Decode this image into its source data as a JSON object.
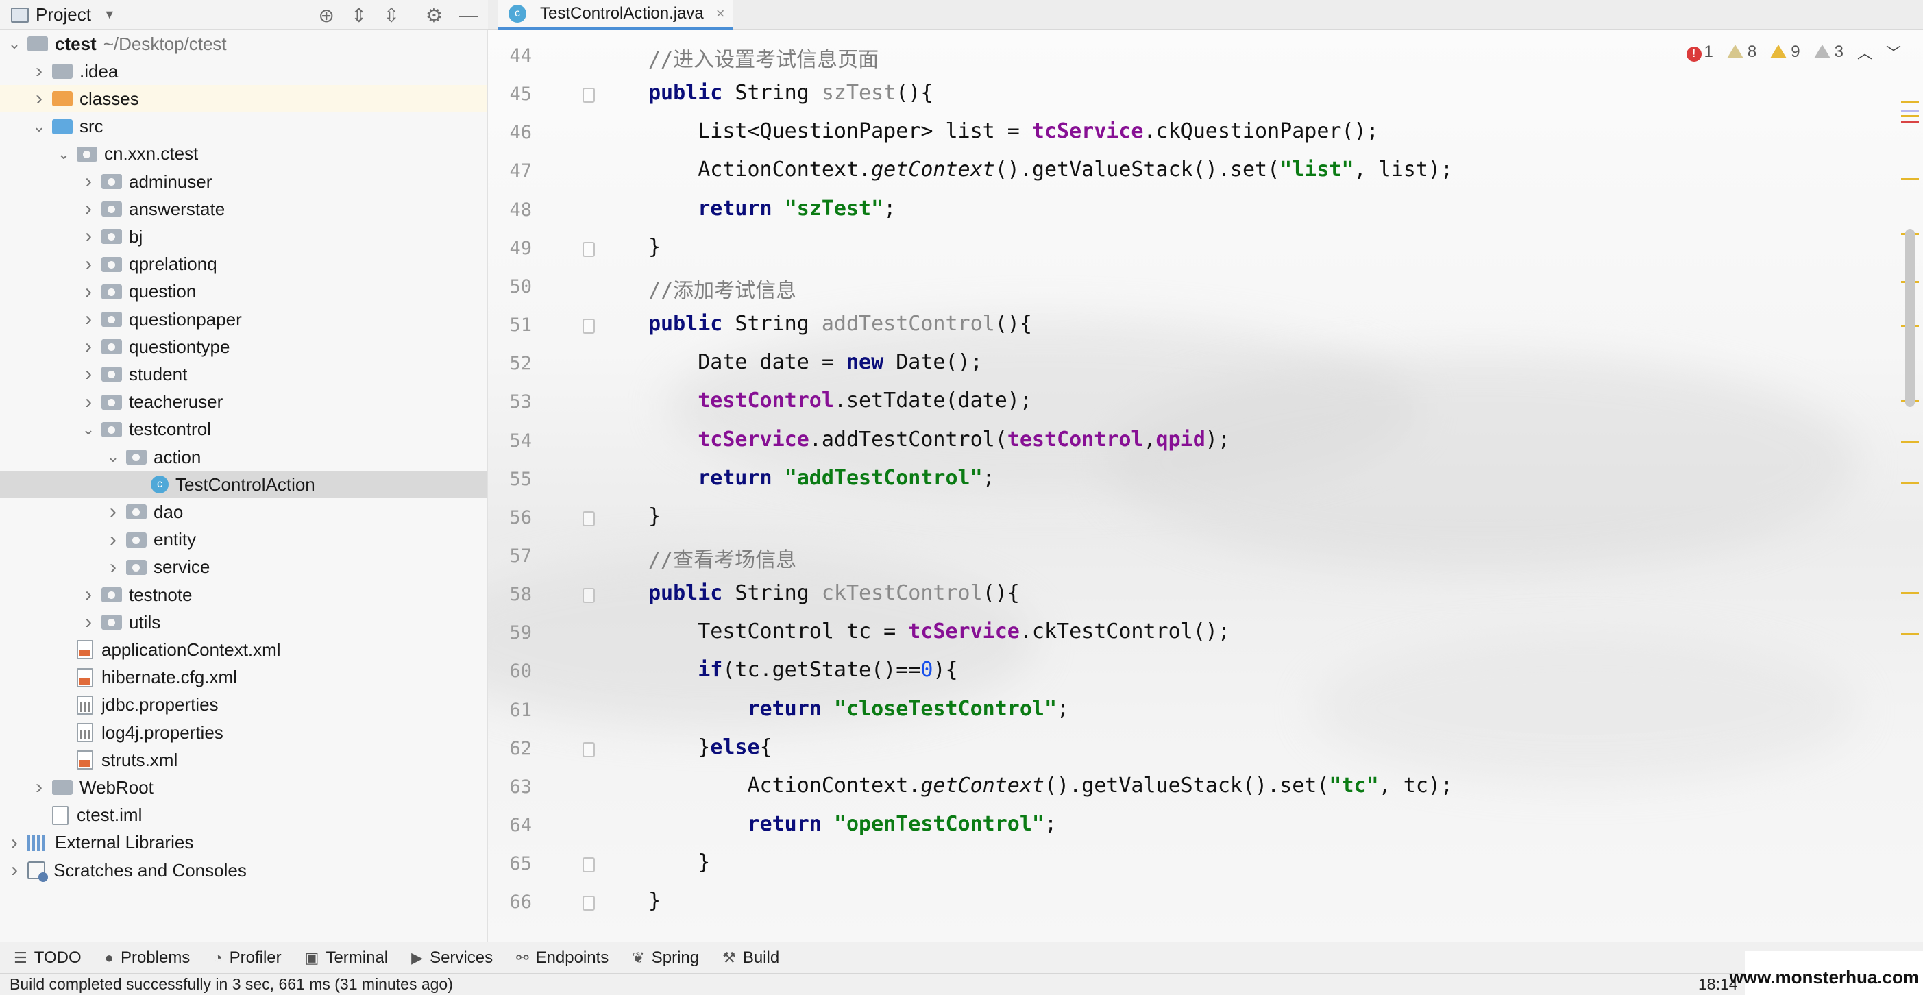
{
  "project_panel": {
    "title": "Project",
    "tree": [
      {
        "label": "ctest",
        "extra": "~/Desktop/ctest",
        "depth": 0,
        "arrow": "down",
        "icon": "gray",
        "bold": true
      },
      {
        "label": ".idea",
        "depth": 1,
        "arrow": "right",
        "icon": "gray"
      },
      {
        "label": "classes",
        "depth": 1,
        "arrow": "right",
        "icon": "orange",
        "highlight": true
      },
      {
        "label": "src",
        "depth": 1,
        "arrow": "down",
        "icon": "blue"
      },
      {
        "label": "cn.xxn.ctest",
        "depth": 2,
        "arrow": "down",
        "icon": "pkg"
      },
      {
        "label": "adminuser",
        "depth": 3,
        "arrow": "right",
        "icon": "pkg"
      },
      {
        "label": "answerstate",
        "depth": 3,
        "arrow": "right",
        "icon": "pkg"
      },
      {
        "label": "bj",
        "depth": 3,
        "arrow": "right",
        "icon": "pkg"
      },
      {
        "label": "qprelationq",
        "depth": 3,
        "arrow": "right",
        "icon": "pkg"
      },
      {
        "label": "question",
        "depth": 3,
        "arrow": "right",
        "icon": "pkg"
      },
      {
        "label": "questionpaper",
        "depth": 3,
        "arrow": "right",
        "icon": "pkg"
      },
      {
        "label": "questiontype",
        "depth": 3,
        "arrow": "right",
        "icon": "pkg"
      },
      {
        "label": "student",
        "depth": 3,
        "arrow": "right",
        "icon": "pkg"
      },
      {
        "label": "teacheruser",
        "depth": 3,
        "arrow": "right",
        "icon": "pkg"
      },
      {
        "label": "testcontrol",
        "depth": 3,
        "arrow": "down",
        "icon": "pkg"
      },
      {
        "label": "action",
        "depth": 4,
        "arrow": "down",
        "icon": "pkg"
      },
      {
        "label": "TestControlAction",
        "depth": 5,
        "arrow": "none",
        "icon": "class",
        "selected": true
      },
      {
        "label": "dao",
        "depth": 4,
        "arrow": "right",
        "icon": "pkg"
      },
      {
        "label": "entity",
        "depth": 4,
        "arrow": "right",
        "icon": "pkg"
      },
      {
        "label": "service",
        "depth": 4,
        "arrow": "right",
        "icon": "pkg"
      },
      {
        "label": "testnote",
        "depth": 3,
        "arrow": "right",
        "icon": "pkg"
      },
      {
        "label": "utils",
        "depth": 3,
        "arrow": "right",
        "icon": "pkg"
      },
      {
        "label": "applicationContext.xml",
        "depth": 2,
        "arrow": "none",
        "icon": "xml"
      },
      {
        "label": "hibernate.cfg.xml",
        "depth": 2,
        "arrow": "none",
        "icon": "xml"
      },
      {
        "label": "jdbc.properties",
        "depth": 2,
        "arrow": "none",
        "icon": "prop"
      },
      {
        "label": "log4j.properties",
        "depth": 2,
        "arrow": "none",
        "icon": "prop"
      },
      {
        "label": "struts.xml",
        "depth": 2,
        "arrow": "none",
        "icon": "xml"
      },
      {
        "label": "WebRoot",
        "depth": 1,
        "arrow": "right",
        "icon": "gray"
      },
      {
        "label": "ctest.iml",
        "depth": 1,
        "arrow": "none",
        "icon": "file"
      },
      {
        "label": "External Libraries",
        "depth": 0,
        "arrow": "right",
        "icon": "lib"
      },
      {
        "label": "Scratches and Consoles",
        "depth": 0,
        "arrow": "right",
        "icon": "scratch"
      }
    ]
  },
  "editor_tab": {
    "label": "TestControlAction.java",
    "close": "×"
  },
  "inspections": {
    "errors": "1",
    "warnings_a": "8",
    "warnings_b": "9",
    "weak": "3"
  },
  "line_numbers": [
    "44",
    "45",
    "46",
    "47",
    "48",
    "49",
    "50",
    "51",
    "52",
    "53",
    "54",
    "55",
    "56",
    "57",
    "58",
    "59",
    "60",
    "61",
    "62",
    "63",
    "64",
    "65",
    "66"
  ],
  "code_lines": [
    [
      {
        "t": "//进入设置考试信息页面",
        "c": "cm"
      }
    ],
    [
      {
        "t": "public",
        "c": "kw"
      },
      {
        "t": " String "
      },
      {
        "t": "szTest",
        "c": "mdn"
      },
      {
        "t": "(){"
      }
    ],
    [
      {
        "t": "    List<QuestionPaper> list = "
      },
      {
        "t": "tcService",
        "c": "fld"
      },
      {
        "t": ".ckQuestionPaper();"
      }
    ],
    [
      {
        "t": "    ActionContext."
      },
      {
        "t": "getContext",
        "c": "it"
      },
      {
        "t": "().getValueStack().set("
      },
      {
        "t": "\"list\"",
        "c": "str"
      },
      {
        "t": ", list);"
      }
    ],
    [
      {
        "t": "    "
      },
      {
        "t": "return",
        "c": "kw"
      },
      {
        "t": " "
      },
      {
        "t": "\"szTest\"",
        "c": "str"
      },
      {
        "t": ";"
      }
    ],
    [
      {
        "t": "}"
      }
    ],
    [
      {
        "t": "//添加考试信息",
        "c": "cm"
      }
    ],
    [
      {
        "t": "public",
        "c": "kw"
      },
      {
        "t": " String "
      },
      {
        "t": "addTestControl",
        "c": "mdn"
      },
      {
        "t": "(){"
      }
    ],
    [
      {
        "t": "    Date date = "
      },
      {
        "t": "new",
        "c": "kw"
      },
      {
        "t": " Date();"
      }
    ],
    [
      {
        "t": "    "
      },
      {
        "t": "testControl",
        "c": "fld"
      },
      {
        "t": ".setTdate(date);"
      }
    ],
    [
      {
        "t": "    "
      },
      {
        "t": "tcService",
        "c": "fld"
      },
      {
        "t": ".addTestControl("
      },
      {
        "t": "testControl",
        "c": "fld"
      },
      {
        "t": ","
      },
      {
        "t": "qpid",
        "c": "fld"
      },
      {
        "t": ");"
      }
    ],
    [
      {
        "t": "    "
      },
      {
        "t": "return",
        "c": "kw"
      },
      {
        "t": " "
      },
      {
        "t": "\"addTestControl\"",
        "c": "str"
      },
      {
        "t": ";"
      }
    ],
    [
      {
        "t": "}"
      }
    ],
    [
      {
        "t": "//查看考场信息",
        "c": "cm"
      }
    ],
    [
      {
        "t": "public",
        "c": "kw"
      },
      {
        "t": " String "
      },
      {
        "t": "ckTestControl",
        "c": "mdn"
      },
      {
        "t": "(){"
      }
    ],
    [
      {
        "t": "    TestControl tc = "
      },
      {
        "t": "tcService",
        "c": "fld"
      },
      {
        "t": ".ckTestControl();"
      }
    ],
    [
      {
        "t": "    "
      },
      {
        "t": "if",
        "c": "kw"
      },
      {
        "t": "(tc.getState()=="
      },
      {
        "t": "0",
        "c": "num"
      },
      {
        "t": "){"
      }
    ],
    [
      {
        "t": "        "
      },
      {
        "t": "return",
        "c": "kw"
      },
      {
        "t": " "
      },
      {
        "t": "\"closeTestControl\"",
        "c": "str"
      },
      {
        "t": ";"
      }
    ],
    [
      {
        "t": "    }"
      },
      {
        "t": "else",
        "c": "kw"
      },
      {
        "t": "{"
      }
    ],
    [
      {
        "t": "        ActionContext."
      },
      {
        "t": "getContext",
        "c": "it"
      },
      {
        "t": "().getValueStack().set("
      },
      {
        "t": "\"tc\"",
        "c": "str"
      },
      {
        "t": ", tc);"
      }
    ],
    [
      {
        "t": "        "
      },
      {
        "t": "return",
        "c": "kw"
      },
      {
        "t": " "
      },
      {
        "t": "\"openTestControl\"",
        "c": "str"
      },
      {
        "t": ";"
      }
    ],
    [
      {
        "t": "    }"
      }
    ],
    [
      {
        "t": "}"
      }
    ]
  ],
  "fold_lines": [
    "45",
    "49",
    "51",
    "56",
    "58",
    "62",
    "65",
    "66"
  ],
  "tool_windows": [
    {
      "label": "TODO",
      "icon": "list-icon",
      "glyph": "☰"
    },
    {
      "label": "Problems",
      "icon": "problems-icon",
      "glyph": "●"
    },
    {
      "label": "Profiler",
      "icon": "profiler-icon",
      "glyph": "◔"
    },
    {
      "label": "Terminal",
      "icon": "terminal-icon",
      "glyph": "▣"
    },
    {
      "label": "Services",
      "icon": "services-icon",
      "glyph": "▶"
    },
    {
      "label": "Endpoints",
      "icon": "endpoints-icon",
      "glyph": "⚯"
    },
    {
      "label": "Spring",
      "icon": "spring-icon",
      "glyph": "❦"
    },
    {
      "label": "Build",
      "icon": "build-icon",
      "glyph": "⚒"
    }
  ],
  "status": {
    "message": "Build completed successfully in 3 sec, 661 ms (31 minutes ago)",
    "time": "18:14"
  },
  "watermark": "www.monsterhua.com"
}
